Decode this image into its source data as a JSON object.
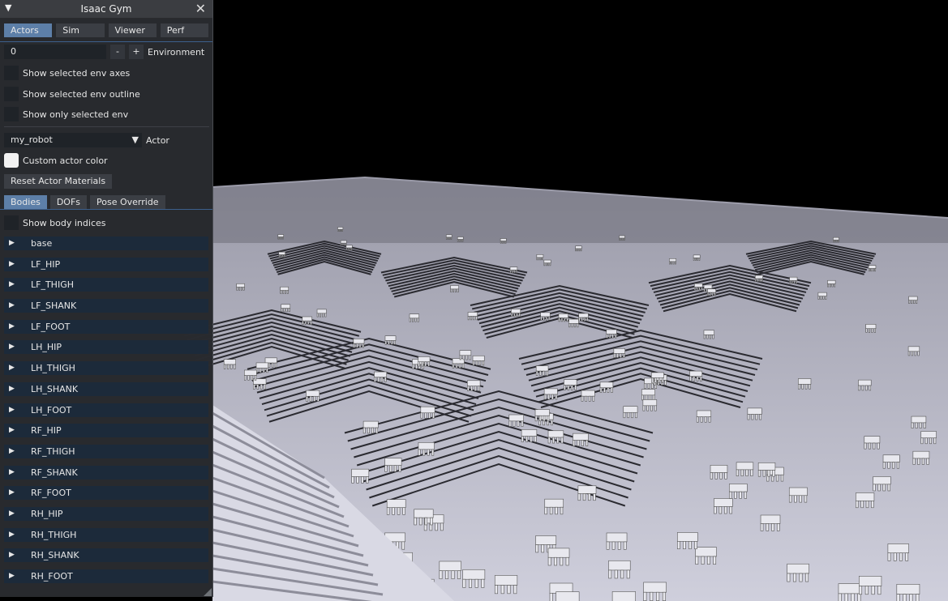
{
  "window": {
    "title": "Isaac Gym"
  },
  "icons": {
    "collapse": "triangle-down-icon",
    "close": "close-x-icon",
    "dropdown": "triangle-down-icon",
    "expand": "triangle-right-icon"
  },
  "tabs": [
    "Actors",
    "Sim",
    "Viewer",
    "Perf"
  ],
  "environment": {
    "value": "0",
    "minus": "-",
    "plus": "+",
    "label": "Environment"
  },
  "checkboxes": [
    {
      "label": "Show selected env axes"
    },
    {
      "label": "Show selected env outline"
    },
    {
      "label": "Show only selected env"
    }
  ],
  "actor": {
    "selected": "my_robot",
    "label": "Actor"
  },
  "custom_color": {
    "label": "Custom actor color"
  },
  "reset_button": "Reset Actor Materials",
  "subtabs": [
    "Bodies",
    "DOFs",
    "Pose Override"
  ],
  "show_body_indices": "Show body indices",
  "bodies": [
    "base",
    "LF_HIP",
    "LF_THIGH",
    "LF_SHANK",
    "LF_FOOT",
    "LH_HIP",
    "LH_THIGH",
    "LH_SHANK",
    "LH_FOOT",
    "RF_HIP",
    "RF_THIGH",
    "RF_SHANK",
    "RF_FOOT",
    "RH_HIP",
    "RH_THIGH",
    "RH_SHANK",
    "RH_FOOT"
  ],
  "colors": {
    "panel": "#2a2c30",
    "accent": "#5d7fa8",
    "tree_item": "#1c2a3a",
    "ground": "#c8c8d6",
    "sky": "#000000"
  }
}
